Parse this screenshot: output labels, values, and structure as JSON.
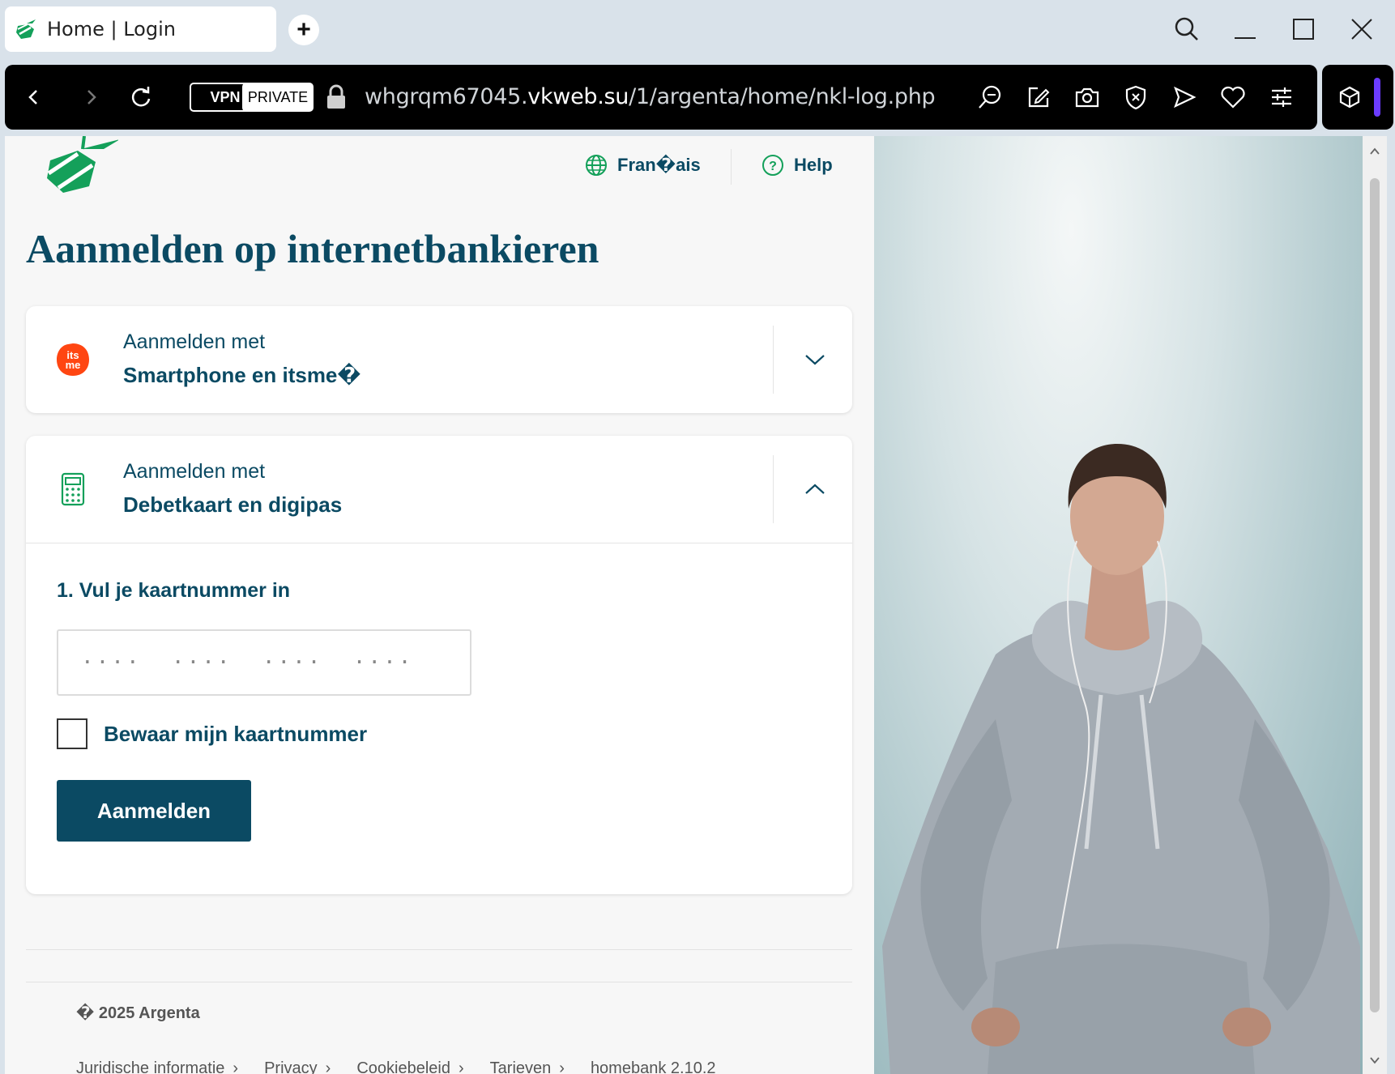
{
  "browser": {
    "tab_title": "Home | Login",
    "new_tab_label": "+",
    "vpn_label": "VPN",
    "private_label": "PRIVATE",
    "url_prefix": "whgrqm67045.",
    "url_host": "vkweb.su",
    "url_path": "/1/argenta/home/nkl-log.php"
  },
  "header": {
    "language_label": "Fran�ais",
    "help_label": "Help"
  },
  "page": {
    "title": "Aanmelden op internetbankieren"
  },
  "cards": [
    {
      "subtitle": "Aanmelden met",
      "title": "Smartphone en itsme�",
      "icon_text_top": "its",
      "icon_text_bottom": "me",
      "expanded": false
    },
    {
      "subtitle": "Aanmelden met",
      "title": "Debetkaart en digipas",
      "expanded": true,
      "step_label": "1. Vul je kaartnummer in",
      "card_number_value": "",
      "card_number_placeholder": "····  ····  ····  ····",
      "remember_label": "Bewaar mijn kaartnummer",
      "remember_checked": false,
      "submit_label": "Aanmelden"
    }
  ],
  "footer": {
    "copyright": "� 2025 Argenta",
    "links": [
      "Juridische informatie",
      "Privacy",
      "Cookiebeleid",
      "Tarieven"
    ],
    "version": "homebank 2.10.2"
  },
  "colors": {
    "brand_primary": "#0b4a63",
    "brand_green": "#14a05a",
    "itsme_orange": "#ff4612"
  }
}
